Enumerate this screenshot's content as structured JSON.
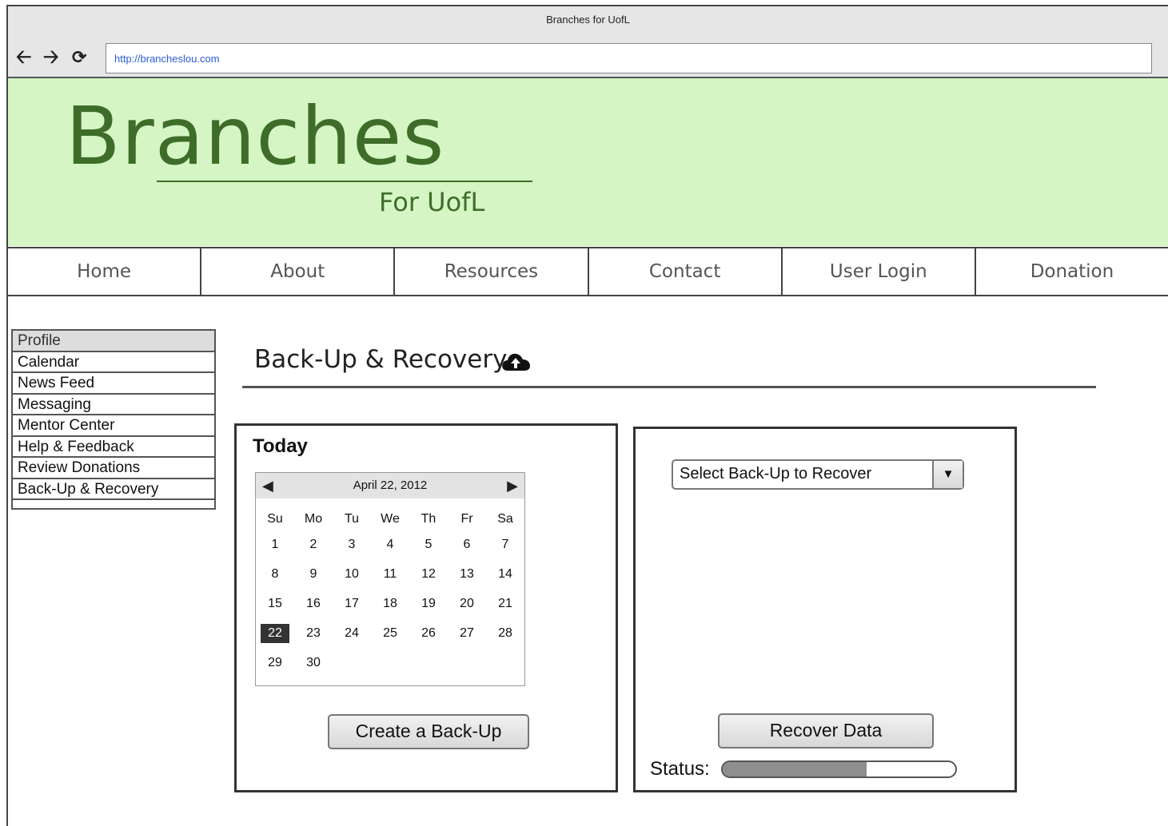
{
  "browser": {
    "window_title": "Branches for UofL",
    "url": "http://brancheslou.com"
  },
  "banner": {
    "logo": "Branches",
    "subtitle": "For UofL",
    "background": "#d5f5c4",
    "accent": "#3e6d2a"
  },
  "nav": {
    "items": [
      "Home",
      "About",
      "Resources",
      "Contact",
      "User Login",
      "Donation"
    ]
  },
  "sidebar": {
    "items": [
      "Profile",
      "Calendar",
      "News Feed",
      "Messaging",
      "Mentor Center",
      "Help & Feedback",
      "Review Donations",
      "Back-Up & Recovery"
    ]
  },
  "page": {
    "title": "Back-Up & Recovery",
    "title_icon": "cloud-upload-icon"
  },
  "backup_panel": {
    "heading": "Today",
    "calendar": {
      "month_label": "April 22, 2012",
      "prev_icon": "◀",
      "next_icon": "▶",
      "days_of_week": [
        "Su",
        "Mo",
        "Tu",
        "We",
        "Th",
        "Fr",
        "Sa"
      ],
      "weeks": [
        [
          "1",
          "2",
          "3",
          "4",
          "5",
          "6",
          "7"
        ],
        [
          "8",
          "9",
          "10",
          "11",
          "12",
          "13",
          "14"
        ],
        [
          "15",
          "16",
          "17",
          "18",
          "19",
          "20",
          "21"
        ],
        [
          "22",
          "23",
          "24",
          "25",
          "26",
          "27",
          "28"
        ],
        [
          "29",
          "30",
          "",
          "",
          "",
          "",
          ""
        ]
      ],
      "selected_day": "22"
    },
    "button": "Create a Back-Up"
  },
  "recover_panel": {
    "select_value": "Select Back-Up to Recover",
    "select_arrow": "▼",
    "button": "Recover Data",
    "status_label": "Status:",
    "status_progress": 0.62
  }
}
